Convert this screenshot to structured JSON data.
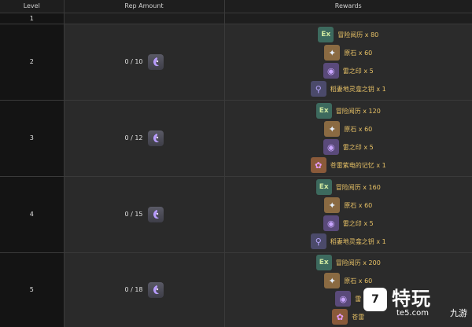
{
  "table": {
    "headers": [
      "Level",
      "Rep Amount",
      "Rewards"
    ],
    "rows": [
      {
        "level": "1",
        "rep": "",
        "rewards": []
      },
      {
        "level": "2",
        "rep": "0 / 10",
        "rewards": [
          {
            "icon": "exp-book-icon",
            "label": "冒险阅历 x 80"
          },
          {
            "icon": "primogem-icon",
            "label": "原石 x 60"
          },
          {
            "icon": "electro-seal-icon",
            "label": "雷之印 x 5"
          },
          {
            "icon": "key-icon",
            "label": "稻妻地灵龛之钥 x 1"
          }
        ]
      },
      {
        "level": "3",
        "rep": "0 / 12",
        "rewards": [
          {
            "icon": "exp-book-icon",
            "label": "冒险阅历 x 120"
          },
          {
            "icon": "primogem-icon",
            "label": "原石 x 60"
          },
          {
            "icon": "electro-seal-icon",
            "label": "雷之印 x 5"
          },
          {
            "icon": "memory-icon",
            "label": "苍雷紫电的记忆 x 1"
          }
        ]
      },
      {
        "level": "4",
        "rep": "0 / 15",
        "rewards": [
          {
            "icon": "exp-book-icon",
            "label": "冒险阅历 x 160"
          },
          {
            "icon": "primogem-icon",
            "label": "原石 x 60"
          },
          {
            "icon": "electro-seal-icon",
            "label": "雷之印 x 5"
          },
          {
            "icon": "key-icon",
            "label": "稻妻地灵龛之钥 x 1"
          }
        ]
      },
      {
        "level": "5",
        "rep": "0 / 18",
        "rewards": [
          {
            "icon": "exp-book-icon",
            "label": "冒险阅历 x 200"
          },
          {
            "icon": "primogem-icon",
            "label": "原石 x 60"
          },
          {
            "icon": "electro-seal-icon",
            "label": "雷"
          },
          {
            "icon": "memory-icon",
            "label": "苍雷"
          }
        ]
      }
    ]
  },
  "watermark": {
    "main": "特玩",
    "sub": "te5.com",
    "logo": "7",
    "corner": "九游"
  },
  "colors": {
    "reward_text": "#e8c266",
    "background": "#1b1b1b"
  }
}
